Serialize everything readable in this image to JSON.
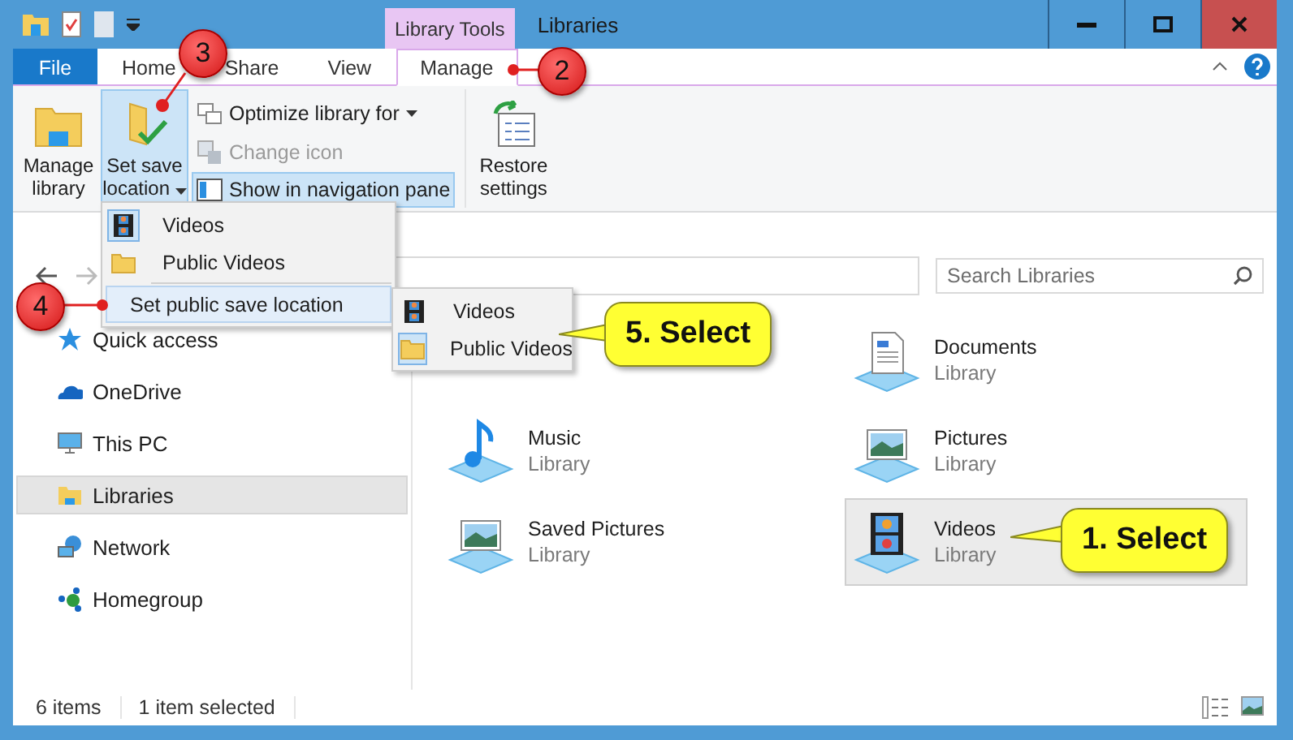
{
  "window": {
    "title": "Libraries",
    "context_tab_group": "Library Tools"
  },
  "ribbon_tabs": [
    {
      "label": "File",
      "kind": "file",
      "selected": false
    },
    {
      "label": "Home",
      "kind": "tab",
      "selected": false
    },
    {
      "label": "Share",
      "kind": "tab",
      "selected": false
    },
    {
      "label": "View",
      "kind": "tab",
      "selected": false
    },
    {
      "label": "Manage",
      "kind": "tab",
      "selected": true
    }
  ],
  "ribbon": {
    "large_left": [
      {
        "label": "Manage library",
        "kind": "library",
        "selected": false
      },
      {
        "label": "Set save location",
        "kind": "save",
        "dropdown": true,
        "selected": true
      }
    ],
    "small": [
      {
        "label": "Optimize library for",
        "kind": "optimize",
        "dropdown": true,
        "disabled": false,
        "selected": false
      },
      {
        "label": "Change icon",
        "kind": "icon",
        "disabled": true,
        "selected": false
      },
      {
        "label": "Show in navigation pane",
        "kind": "nav",
        "disabled": false,
        "selected": true
      }
    ],
    "large_right": [
      {
        "label": "Restore settings",
        "kind": "restore",
        "selected": false
      }
    ]
  },
  "save_menu": {
    "items": [
      {
        "label": "Videos",
        "kind": "video",
        "selected": true
      },
      {
        "label": "Public Videos",
        "kind": "folder",
        "selected": false
      }
    ],
    "submenu_label": "Set public save location",
    "submenu": [
      {
        "label": "Videos",
        "kind": "video",
        "selected": false
      },
      {
        "label": "Public Videos",
        "kind": "folder",
        "selected": true
      }
    ]
  },
  "search": {
    "placeholder": "Search Libraries"
  },
  "navigation": [
    {
      "label": "Quick access",
      "kind": "star",
      "selected": false
    },
    {
      "label": "OneDrive",
      "kind": "cloud",
      "selected": false
    },
    {
      "label": "This PC",
      "kind": "pc",
      "selected": false
    },
    {
      "label": "Libraries",
      "kind": "libraries",
      "selected": true
    },
    {
      "label": "Network",
      "kind": "network",
      "selected": false
    },
    {
      "label": "Homegroup",
      "kind": "homegroup",
      "selected": false
    }
  ],
  "libraries": [
    {
      "name": "Documents",
      "type": "Library",
      "kind": "documents",
      "selected": false
    },
    {
      "name": "Music",
      "type": "Library",
      "kind": "music",
      "selected": false
    },
    {
      "name": "Pictures",
      "type": "Library",
      "kind": "pictures",
      "selected": false
    },
    {
      "name": "Saved Pictures",
      "type": "Library",
      "kind": "pictures",
      "selected": false
    },
    {
      "name": "Videos",
      "type": "Library",
      "kind": "video",
      "selected": true
    }
  ],
  "status_bar": {
    "items": "6 items",
    "selection": "1 item selected"
  },
  "annotations": [
    {
      "kind": "marker",
      "label": "2"
    },
    {
      "kind": "marker",
      "label": "3"
    },
    {
      "kind": "marker",
      "label": "4"
    },
    {
      "kind": "callout",
      "label": "5. Select"
    },
    {
      "kind": "callout",
      "label": "1. Select"
    }
  ]
}
